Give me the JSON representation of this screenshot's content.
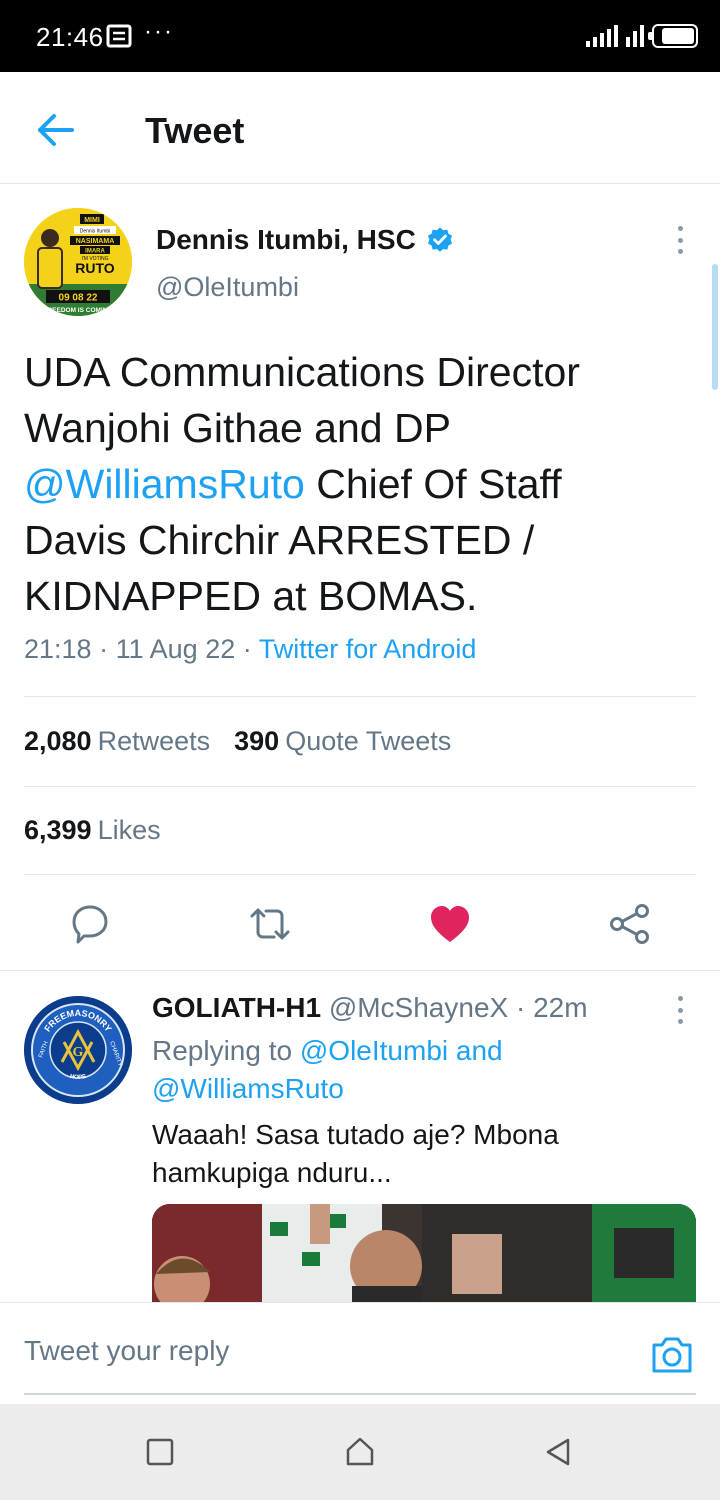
{
  "status_bar": {
    "time": "21:46",
    "more": "···"
  },
  "header": {
    "title": "Tweet"
  },
  "tweet": {
    "author_name": "Dennis Itumbi, HSC",
    "author_handle": "@OleItumbi",
    "text_part1": "UDA Communications Director Wanjohi Githae and DP ",
    "mention": "@WilliamsRuto",
    "text_part2": " Chief Of Staff Davis Chirchir ARRESTED / KIDNAPPED at BOMAS.",
    "time": "21:18",
    "date": "11 Aug 22",
    "source": "Twitter for Android",
    "separator": "·",
    "avatar_text": {
      "line1": "MIMI",
      "line2": "Dennis Itumbi",
      "line3": "NASIMAMA",
      "line4": "IMARA",
      "line5": "I'M VOTING",
      "line6": "RUTO",
      "line7": "09 08 22",
      "line8": "FREEDOM IS COMING"
    }
  },
  "stats": {
    "retweets_count": "2,080",
    "retweets_label": "Retweets",
    "quotes_count": "390",
    "quotes_label": "Quote Tweets",
    "likes_count": "6,399",
    "likes_label": "Likes"
  },
  "actions": {
    "reply_icon": "comment-icon",
    "retweet_icon": "retweet-icon",
    "like_icon": "heart-filled-icon",
    "share_icon": "share-icon",
    "like_color": "#e0245e",
    "icon_color": "#657786"
  },
  "reply": {
    "name": "GOLIATH-H1",
    "handle": "@McShayneX",
    "separator": "·",
    "time": "22m",
    "replying_prefix": "Replying to ",
    "replying_user1": "@OleItumbi",
    "replying_and": " and",
    "replying_user2": "@WilliamsRuto",
    "text": "Waaah! Sasa tutado aje? Mbona hamkupiga nduru...",
    "avatar_text": {
      "top": "FREEMASONRY",
      "left": "FAITH",
      "bottom": "HOPE",
      "right": "CHARITY",
      "center": "G"
    }
  },
  "reply_bar": {
    "placeholder": "Tweet your reply"
  },
  "colors": {
    "accent": "#1da1f2",
    "secondary_text": "#657786",
    "divider": "#e1e8ed"
  }
}
